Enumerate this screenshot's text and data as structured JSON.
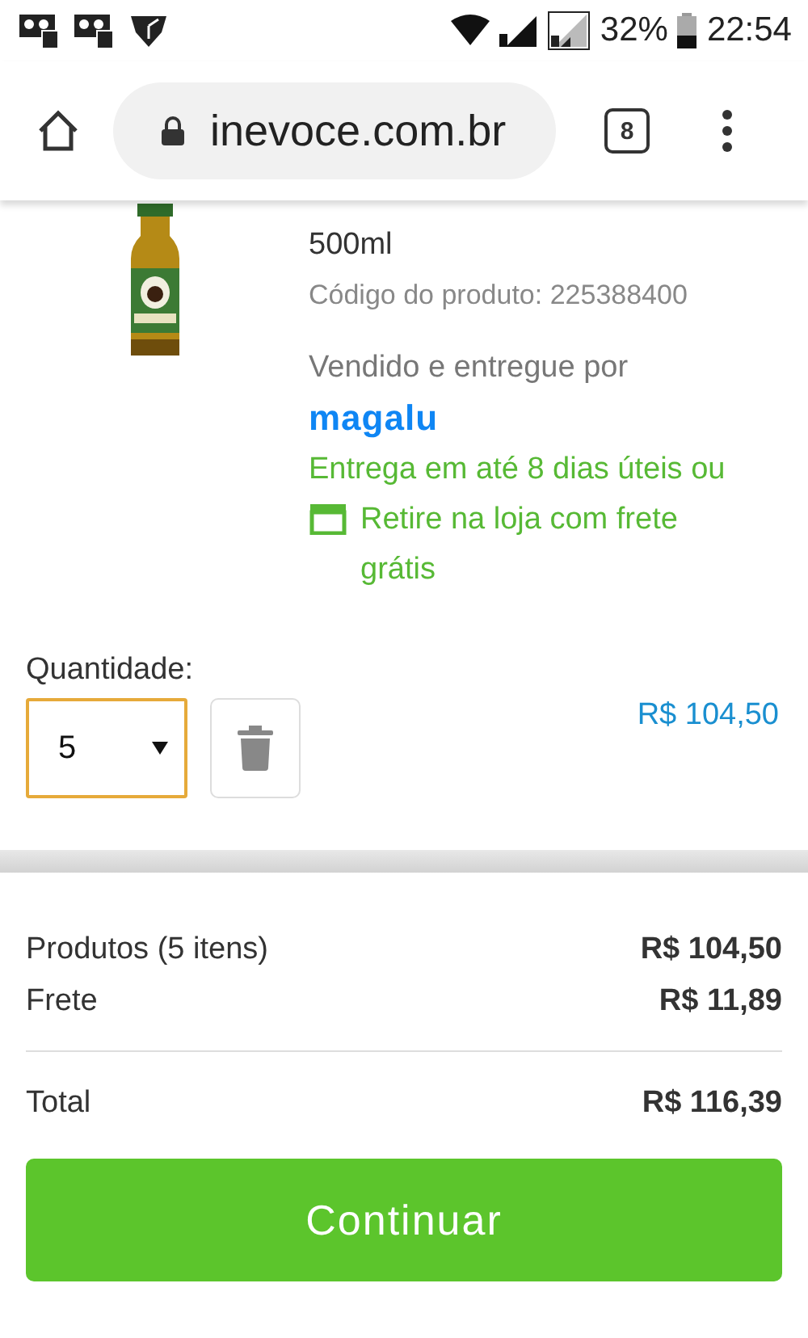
{
  "status_bar": {
    "battery": "32%",
    "time": "22:54"
  },
  "browser": {
    "url": "inevoce.com.br",
    "tab_count": "8"
  },
  "product": {
    "size": "500ml",
    "code": "Código do produto: 225388400",
    "seller_label": "Vendido e entregue por",
    "seller": "magalu",
    "delivery": "Entrega em até 8 dias úteis ou",
    "pickup": "Retire na loja com frete grátis"
  },
  "quantity": {
    "label": "Quantidade:",
    "value": "5",
    "price": "R$ 104,50"
  },
  "summary": {
    "rows": [
      {
        "label": "Produtos (5 itens)",
        "value": "R$ 104,50"
      },
      {
        "label": "Frete",
        "value": "R$ 11,89"
      }
    ],
    "total": {
      "label": "Total",
      "value": "R$ 116,39"
    }
  },
  "button": "Continuar"
}
